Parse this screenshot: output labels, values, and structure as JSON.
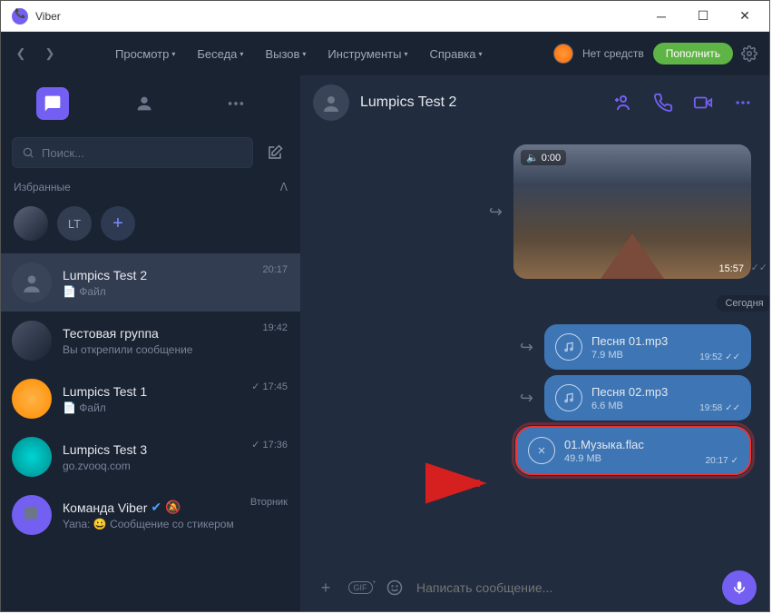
{
  "window": {
    "title": "Viber"
  },
  "toolbar": {
    "menus": {
      "view": "Просмотр",
      "chat": "Беседа",
      "call": "Вызов",
      "tools": "Инструменты",
      "help": "Справка"
    },
    "balance_label": "Нет средств",
    "topup_label": "Пополнить"
  },
  "sidebar": {
    "search_placeholder": "Поиск...",
    "section_favorites": "Избранные",
    "fav_badge": "LT",
    "chats": [
      {
        "name": "Lumpics Test 2",
        "sub": "📄 Файл",
        "time": "20:17",
        "active": true,
        "pinned": true,
        "avatar": "person"
      },
      {
        "name": "Тестовая группа",
        "sub": "Вы открепили сообщение",
        "time": "19:42",
        "avatar": "img1"
      },
      {
        "name": "Lumpics Test 1",
        "sub": "📄 Файл",
        "time": "17:45",
        "read": true,
        "avatar": "orange"
      },
      {
        "name": "Lumpics Test 3",
        "sub": "go.zvooq.com",
        "time": "17:36",
        "read": true,
        "avatar": "cyan"
      },
      {
        "name": "Команда Viber",
        "sub": "Yana: 😀 Сообщение со стикером",
        "time": "Вторник",
        "verified": true,
        "muted": true,
        "avatar": "viber"
      }
    ]
  },
  "chat": {
    "title": "Lumpics Test 2",
    "video": {
      "top_dur": "0:00",
      "bottom_dur": "15:57"
    },
    "date_separator": "Сегодня",
    "files": [
      {
        "name": "Песня 01.mp3",
        "size": "7.9 MB",
        "time": "19:52",
        "kind": "audio"
      },
      {
        "name": "Песня 02.mp3",
        "size": "6.6 MB",
        "time": "19:58",
        "kind": "audio"
      },
      {
        "name": "01.Музыка.flac",
        "size": "49.9 MB",
        "time": "20:17",
        "kind": "uploading"
      }
    ],
    "composer_placeholder": "Написать сообщение..."
  }
}
